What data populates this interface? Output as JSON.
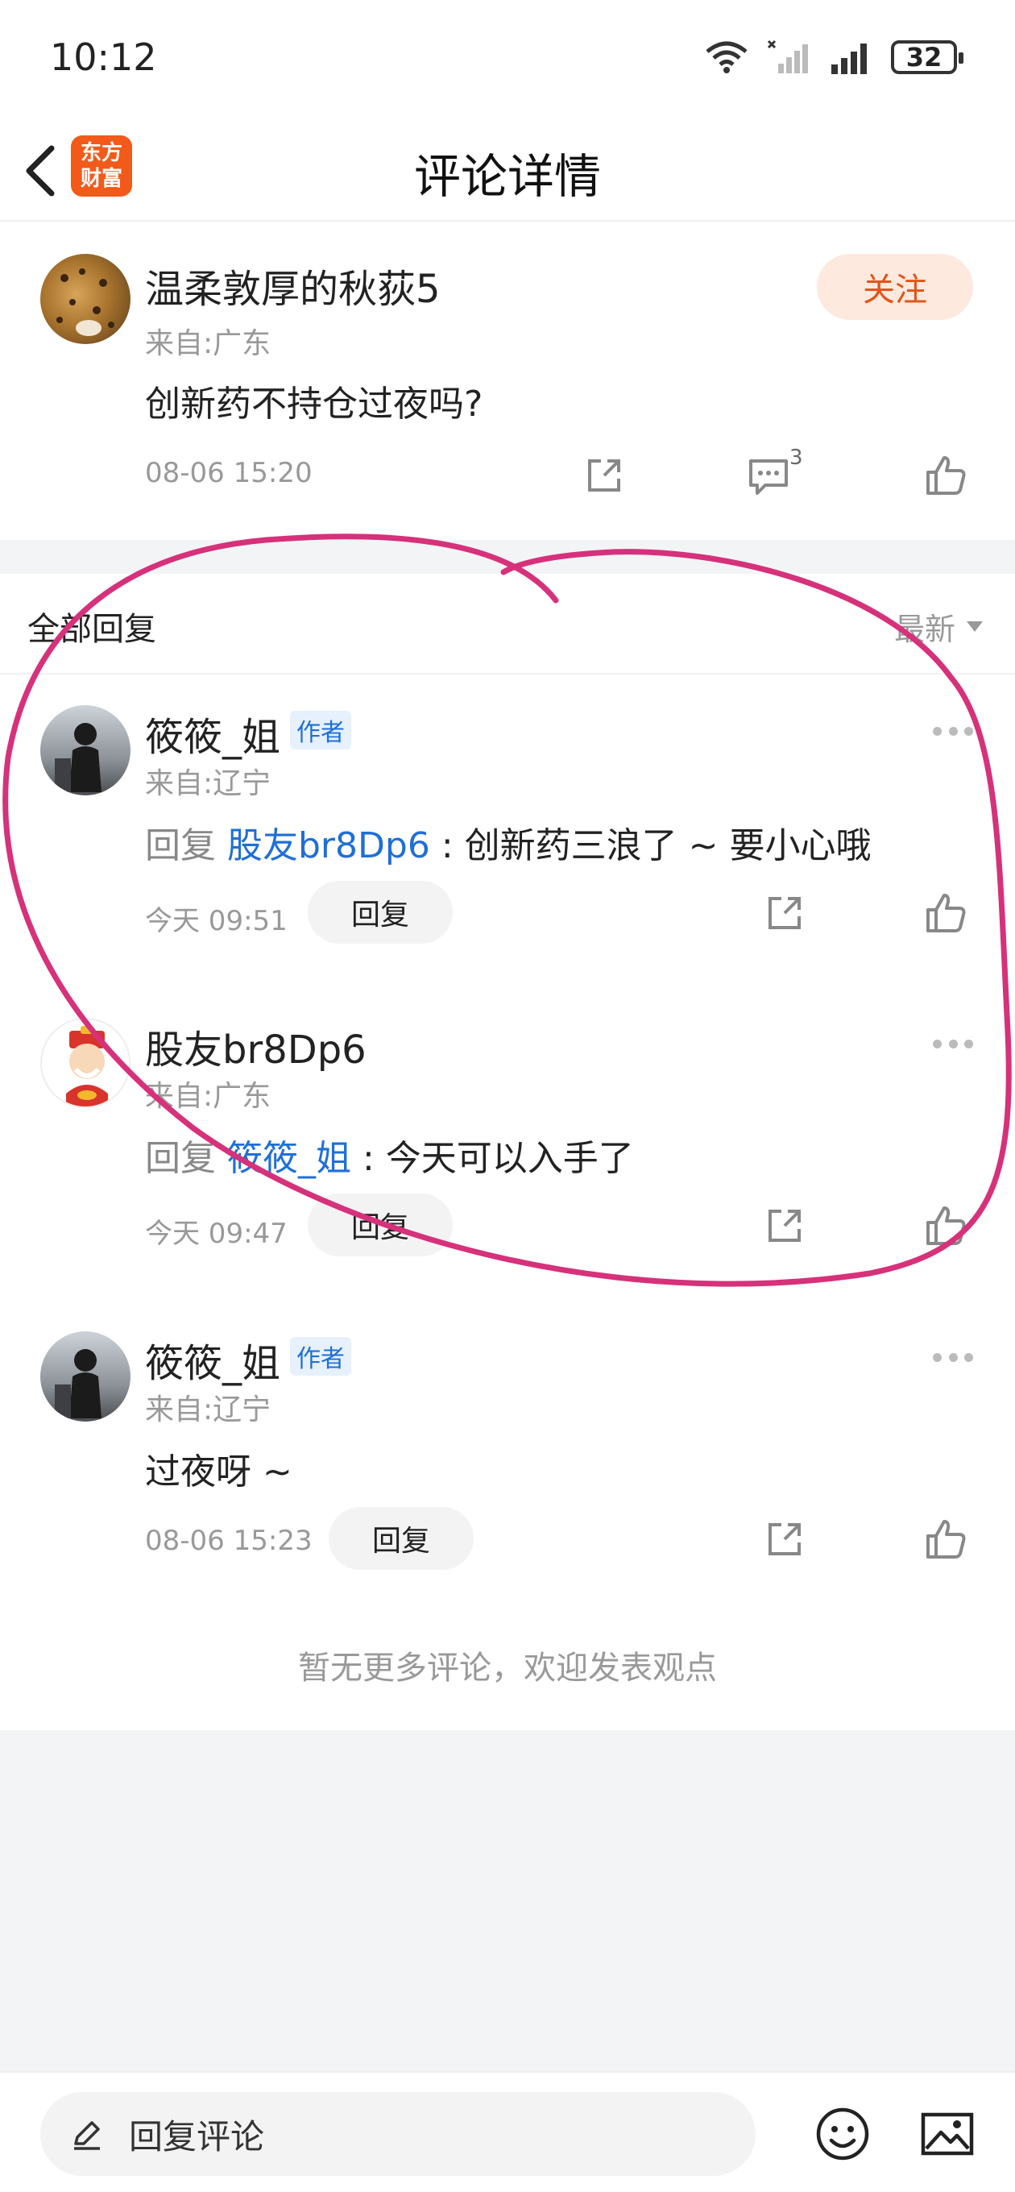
{
  "status_bar": {
    "time": "10:12",
    "battery": "32"
  },
  "header": {
    "title": "评论详情",
    "logo_line1": "东方",
    "logo_line2": "财富"
  },
  "post": {
    "username": "温柔敦厚的秋荻5",
    "location": "来自:广东",
    "content": "创新药不持仓过夜吗?",
    "time": "08-06 15:20",
    "follow_label": "关注",
    "comment_count": "3"
  },
  "replies_section": {
    "title": "全部回复",
    "sort_label": "最新"
  },
  "replies": [
    {
      "username": "筱筱_姐",
      "badge": "作者",
      "location": "来自:辽宁",
      "prefix": "回复",
      "mention": "股友br8Dp6",
      "text": " : 创新药三浪了 ~ 要小心哦",
      "time": "今天 09:51",
      "reply_label": "回复"
    },
    {
      "username": "股友br8Dp6",
      "badge": "",
      "location": "来自:广东",
      "prefix": "回复",
      "mention": "筱筱_姐",
      "text": " : 今天可以入手了",
      "time": "今天 09:47",
      "reply_label": "回复"
    },
    {
      "username": "筱筱_姐",
      "badge": "作者",
      "location": "来自:辽宁",
      "prefix": "",
      "mention": "",
      "text": "过夜呀 ~",
      "time": "08-06 15:23",
      "reply_label": "回复"
    }
  ],
  "footer_note": "暂无更多评论，欢迎发表观点",
  "bottom_bar": {
    "input_placeholder": "回复评论"
  },
  "colors": {
    "accent": "#f25a1a",
    "mention": "#1e6fd8",
    "annotation": "#d6317a"
  }
}
